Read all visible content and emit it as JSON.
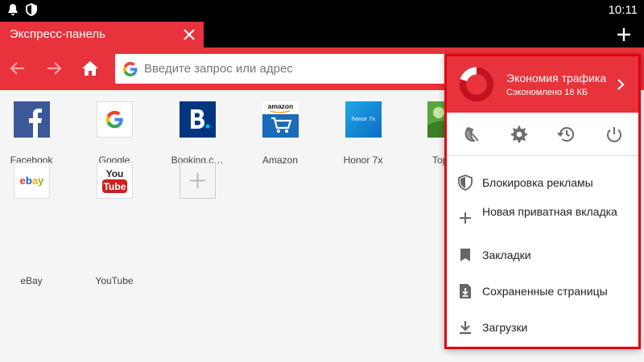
{
  "status_bar": {
    "time": "10:11",
    "icons": [
      "notification-icon",
      "shield-icon"
    ]
  },
  "tab": {
    "title": "Экспресс-панель",
    "icons": [
      "close-icon",
      "plus-icon"
    ]
  },
  "toolbar": {
    "icons": [
      "back-arrow-icon",
      "forward-arrow-icon",
      "home-icon",
      "google-icon"
    ],
    "address_placeholder": "Введите запрос или адрес",
    "address_value": ""
  },
  "speed_dial": [
    {
      "label": "Facebook",
      "icon": "facebook-icon"
    },
    {
      "label": "Google",
      "icon": "google-icon"
    },
    {
      "label": "Booking.c…",
      "icon": "booking-icon"
    },
    {
      "label": "Amazon",
      "icon": "amazon-icon",
      "logo_text": "amazon"
    },
    {
      "label": "Honor 7x",
      "icon": "honor-icon",
      "logo_text": "honor 7x"
    },
    {
      "label": "Top G",
      "icon": "top-g-icon"
    },
    {
      "label": "eBay",
      "icon": "ebay-icon",
      "logo_text": "ebay"
    },
    {
      "label": "YouTube",
      "icon": "youtube-icon",
      "logo_text": [
        "You",
        "Tube"
      ]
    },
    {
      "label": "",
      "icon": "add-tile-icon"
    }
  ],
  "menu": {
    "header": {
      "title": "Экономия трафика",
      "subtitle": "Сэкономлено 18 КБ",
      "icon": "data-savings-icon",
      "saved_fraction": 0.8
    },
    "quick_icons": [
      "night-mode-icon",
      "settings-icon",
      "history-icon",
      "power-icon"
    ],
    "items": [
      {
        "label": "Блокировка рекламы",
        "icon": "shield-icon"
      },
      {
        "label": "Новая приватная вкладка",
        "icon": "plus-icon"
      },
      {
        "label": "Закладки",
        "icon": "bookmark-icon"
      },
      {
        "label": "Сохраненные страницы",
        "icon": "saved-page-icon"
      },
      {
        "label": "Загрузки",
        "icon": "download-icon"
      }
    ]
  },
  "colors": {
    "accent": "#e8323c",
    "menu_border": "#e00010",
    "status_bar": "#000000"
  }
}
